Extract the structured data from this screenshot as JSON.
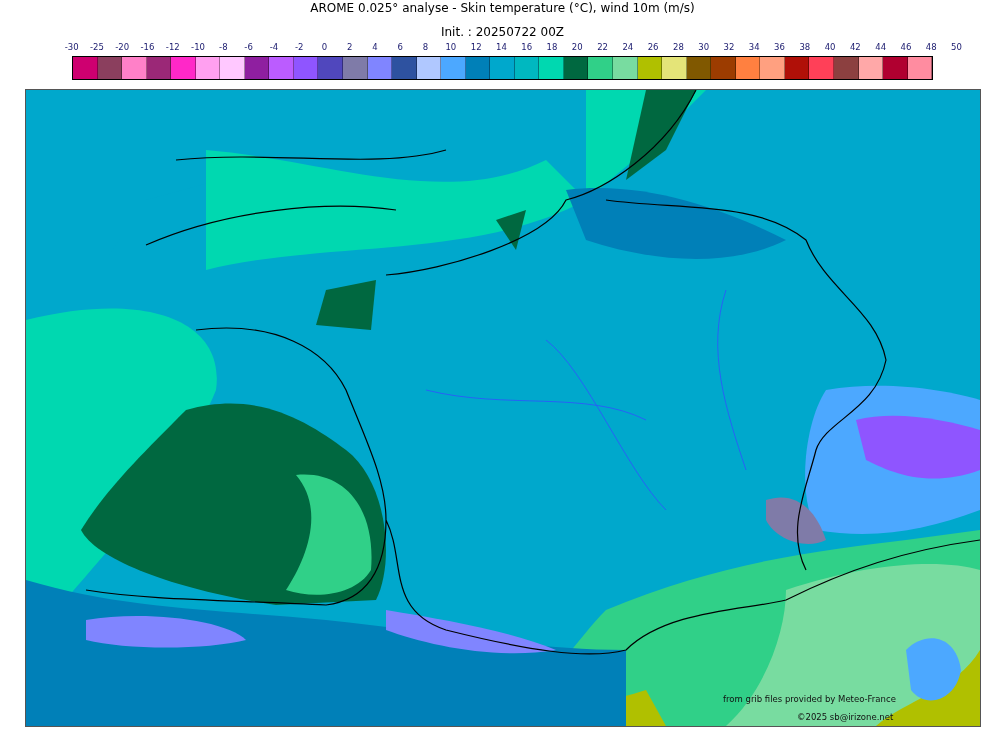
{
  "title": "AROME 0.025° analyse - Skin temperature (°C), wind 10m (m/s)",
  "subtitle": "Init. : 20250722 00Z",
  "colorbar": {
    "ticks": [
      "-30",
      "-25",
      "-20",
      "-16",
      "-12",
      "-10",
      "-8",
      "-6",
      "-4",
      "-2",
      "0",
      "2",
      "4",
      "6",
      "8",
      "10",
      "12",
      "14",
      "16",
      "18",
      "20",
      "22",
      "24",
      "26",
      "28",
      "30",
      "32",
      "34",
      "36",
      "38",
      "40",
      "42",
      "44",
      "46",
      "48",
      "50"
    ],
    "bins": [
      {
        "color": "#ce0070"
      },
      {
        "color": "#8b3f5e"
      },
      {
        "color": "#ff80c8"
      },
      {
        "color": "#9b2877"
      },
      {
        "color": "#ff28c8"
      },
      {
        "color": "#ffa0f0"
      },
      {
        "color": "#ffc8ff"
      },
      {
        "color": "#8f1fa0"
      },
      {
        "color": "#bb5cff"
      },
      {
        "color": "#8f55ff"
      },
      {
        "color": "#5047bd"
      },
      {
        "color": "#7f7ba8"
      },
      {
        "color": "#8085ff"
      },
      {
        "color": "#2e52a0"
      },
      {
        "color": "#b0c8ff"
      },
      {
        "color": "#4ca8ff"
      },
      {
        "color": "#0080b8"
      },
      {
        "color": "#00a8cc"
      },
      {
        "color": "#00b8c0"
      },
      {
        "color": "#00d8b0"
      },
      {
        "color": "#006840"
      },
      {
        "color": "#30d088"
      },
      {
        "color": "#78dca0"
      },
      {
        "color": "#b0c000"
      },
      {
        "color": "#e4e478"
      },
      {
        "color": "#805800"
      },
      {
        "color": "#9c3c00"
      },
      {
        "color": "#ff8040"
      },
      {
        "color": "#ffa080"
      },
      {
        "color": "#b01008"
      },
      {
        "color": "#ff4058"
      },
      {
        "color": "#8c4040"
      },
      {
        "color": "#ffa8a8"
      },
      {
        "color": "#b00030"
      },
      {
        "color": "#ff8ca0"
      }
    ]
  },
  "map": {
    "source_note": "from grib files provided by Meteo-France",
    "copyright": "©2025 sb@irizone.net"
  }
}
